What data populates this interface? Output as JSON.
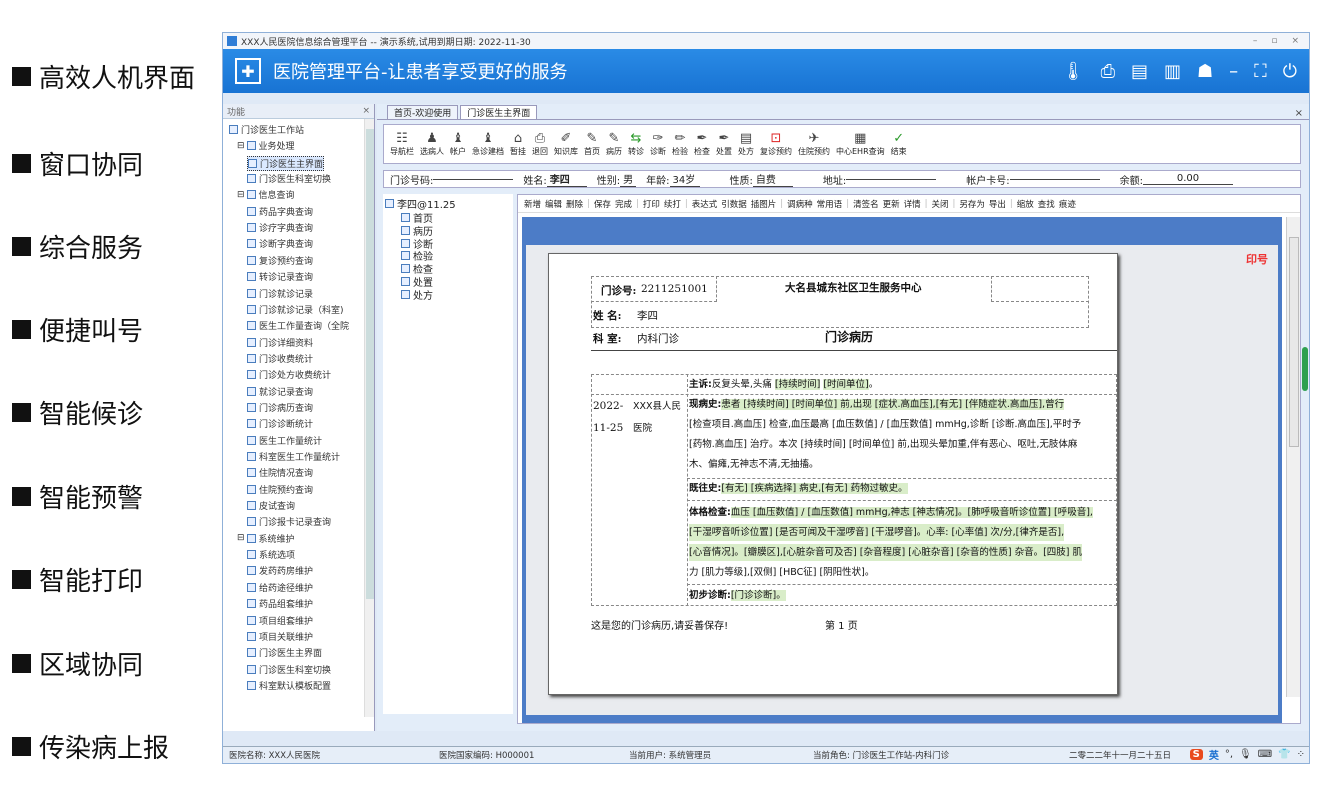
{
  "features": [
    "高效人机界面",
    "窗口协同",
    "综合服务",
    "便捷叫号",
    "智能候诊",
    "智能预警",
    "智能打印",
    "区域协同",
    "传染病上报"
  ],
  "window": {
    "title": "XXX人民医院信息综合管理平台 -- 演示系统,试用到期日期: 2022-11-30",
    "controls": [
      "–",
      "▫",
      "×"
    ]
  },
  "banner": {
    "title": "医院管理平台-让患者享受更好的服务",
    "icons": [
      "thermometer-icon",
      "print-icon",
      "monitor-icon",
      "books-icon",
      "user-icon",
      "minimize-icon",
      "fullscreen-icon",
      "power-icon"
    ]
  },
  "leftpanel": {
    "header": "功能",
    "close": "×",
    "items": [
      {
        "label": "门诊医生工作站",
        "level": 0
      },
      {
        "label": "业务处理",
        "level": 1
      },
      {
        "label": "门诊医生主界面",
        "level": 2,
        "selected": true
      },
      {
        "label": "门诊医生科室切换",
        "level": 2
      },
      {
        "label": "信息查询",
        "level": 1
      },
      {
        "label": "药品字典查询",
        "level": 2
      },
      {
        "label": "诊疗字典查询",
        "level": 2
      },
      {
        "label": "诊断字典查询",
        "level": 2
      },
      {
        "label": "复诊预约查询",
        "level": 2
      },
      {
        "label": "转诊记录查询",
        "level": 2
      },
      {
        "label": "门诊就诊记录",
        "level": 2
      },
      {
        "label": "门诊就诊记录（科室)",
        "level": 2
      },
      {
        "label": "医生工作量查询（全院",
        "level": 2
      },
      {
        "label": "门诊详细资料",
        "level": 2
      },
      {
        "label": "门诊收费统计",
        "level": 2
      },
      {
        "label": "门诊处方收费统计",
        "level": 2
      },
      {
        "label": "就诊记录查询",
        "level": 2
      },
      {
        "label": "门诊病历查询",
        "level": 2
      },
      {
        "label": "门诊诊断统计",
        "level": 2
      },
      {
        "label": "医生工作量统计",
        "level": 2
      },
      {
        "label": "科室医生工作量统计",
        "level": 2
      },
      {
        "label": "住院情况查询",
        "level": 2
      },
      {
        "label": "住院预约查询",
        "level": 2
      },
      {
        "label": "皮试查询",
        "level": 2
      },
      {
        "label": "门诊报卡记录查询",
        "level": 2
      },
      {
        "label": "系统维护",
        "level": 1
      },
      {
        "label": "系统选项",
        "level": 2
      },
      {
        "label": "发药药房维护",
        "level": 2
      },
      {
        "label": "给药途径维护",
        "level": 2
      },
      {
        "label": "药品组套维护",
        "level": 2
      },
      {
        "label": "项目组套维护",
        "level": 2
      },
      {
        "label": "项目关联维护",
        "level": 2
      },
      {
        "label": "门诊医生主界面",
        "level": 2
      },
      {
        "label": "门诊医生科室切换",
        "level": 2
      },
      {
        "label": "科室默认模板配置",
        "level": 2
      }
    ]
  },
  "tabs": [
    {
      "label": "首页-欢迎使用",
      "active": false
    },
    {
      "label": "门诊医生主界面",
      "active": true
    }
  ],
  "toolbar": [
    {
      "label": "导航栏",
      "glyph": "☷"
    },
    {
      "label": "选病人",
      "glyph": "♟"
    },
    {
      "label": "帐户",
      "glyph": "♝"
    },
    {
      "label": "急诊建档",
      "glyph": "♝"
    },
    {
      "label": "暂挂",
      "glyph": "⌂"
    },
    {
      "label": "退回",
      "glyph": "⎙"
    },
    {
      "label": "知识库",
      "glyph": "✐"
    },
    {
      "label": "首页",
      "glyph": "✎"
    },
    {
      "label": "病历",
      "glyph": "✎"
    },
    {
      "label": "转诊",
      "glyph": "⇆",
      "color": "green"
    },
    {
      "label": "诊断",
      "glyph": "✑"
    },
    {
      "label": "检验",
      "glyph": "✏"
    },
    {
      "label": "检查",
      "glyph": "✒"
    },
    {
      "label": "处置",
      "glyph": "✒"
    },
    {
      "label": "处方",
      "glyph": "▤"
    },
    {
      "label": "复诊预约",
      "glyph": "⊡",
      "color": "red"
    },
    {
      "label": "住院预约",
      "glyph": "✈"
    },
    {
      "label": "中心EHR查询",
      "glyph": "▦"
    },
    {
      "label": "结束",
      "glyph": "✓",
      "color": "green"
    }
  ],
  "patient": {
    "id_label": "门诊号码:",
    "id_value": "",
    "name_label": "姓名:",
    "name_value": "李四",
    "sex_label": "性别:",
    "sex_value": "男",
    "age_label": "年龄:",
    "age_value": "34岁",
    "nature_label": "性质:",
    "nature_value": "自费",
    "address_label": "地址:",
    "address_value": "",
    "card_label": "帐户卡号:",
    "card_value": "",
    "balance_label": "余额:",
    "balance_value": "0.00"
  },
  "recordtree": {
    "root": "李四@11.25",
    "children": [
      "首页",
      "病历",
      "诊断",
      "检验",
      "检查",
      "处置",
      "处方"
    ]
  },
  "edtoolbar": [
    "新增",
    "编辑",
    "删除",
    "|",
    "保存",
    "完成",
    "|",
    "打印",
    "续打",
    "|",
    "表达式",
    "引数据",
    "插图片",
    "|",
    "调病种",
    "常用语",
    "|",
    "清签名",
    "更新",
    "详情",
    "|",
    "关闭",
    "|",
    "另存为",
    "导出",
    "|",
    "缩放",
    "查找",
    "痕迹"
  ],
  "record": {
    "clinic_no_label": "门诊号:",
    "clinic_no": "2211251001",
    "hospital": "大名县城东社区卫生服务中心",
    "name_label": "姓  名:",
    "name": "李四",
    "dept_label": "科  室:",
    "dept": "内科门诊",
    "doc_title": "门诊病历",
    "date_line1": "2022-",
    "date_line2": "11-25",
    "hosp_short_line1": "XXX县人民",
    "hosp_short_line2": "医院",
    "chief_label": "主诉:",
    "chief_text": "反复头晕,头痛",
    "chief_tags": [
      "[持续时间]",
      "[时间单位]"
    ],
    "hpi_label": "现病史:",
    "hpi_lines": [
      "患者 [持续时间] [时间单位] 前,出现 [症状.高血压],[有无] [伴随症状.高血压],曾行",
      "[检查项目.高血压] 检查,血压最高 [血压数值] / [血压数值] mmHg,诊断 [诊断.高血压],平时予",
      "[药物.高血压] 治疗。本次 [持续时间] [时间单位] 前,出现头晕加重,伴有恶心、呕吐,无肢体麻",
      "木、偏瘫,无神志不清,无抽搐。"
    ],
    "past_label": "既往史:",
    "past_text": "[有无] [疾病选择] 病史,[有无] 药物过敏史。",
    "exam_label": "体格检查:",
    "exam_lines": [
      "血压 [血压数值] / [血压数值] mmHg,神志 [神志情况]。[肺呼吸音听诊位置] [呼吸音],",
      "[干湿啰音听诊位置] [是否可闻及干湿啰音] [干湿啰音]。心率: [心率值] 次/分,[律齐是否],",
      "[心音情况]。[瓣膜区],[心脏杂音可及否] [杂音程度] [心脏杂音] [杂音的性质] 杂音。[四肢] 肌",
      "力 [肌力等级],[双侧] [HBC征] [阴阳性状]。"
    ],
    "diag_label": "初步诊断:",
    "diag_text": "[门诊诊断]。",
    "footer_note": "这是您的门诊病历,请妥善保存!",
    "page_label": "第  1  页",
    "stamp": "印号"
  },
  "status": {
    "hospital": "医院名称: XXX人民医院",
    "code": "医院国家编码: H000001",
    "user": "当前用户: 系统管理员",
    "role": "当前角色: 门诊医生工作站-内科门诊",
    "date": "二零二二年十一月二十五日"
  },
  "ime": {
    "logo": "S",
    "lang": "英",
    "icons": [
      "punct-icon",
      "mic-icon",
      "keyboard-icon",
      "shirt-icon",
      "grid-icon"
    ]
  }
}
